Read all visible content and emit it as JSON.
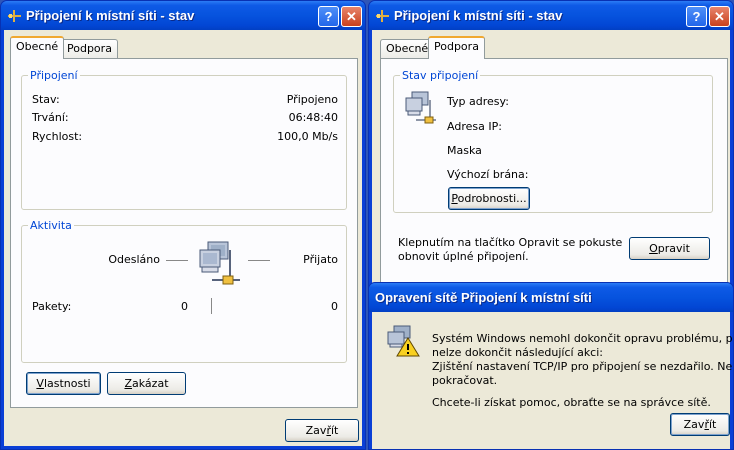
{
  "left_window": {
    "title": "Připojení k místní síti - stav",
    "help": "?",
    "close": "✕",
    "tabs": [
      "Obecné",
      "Podpora"
    ],
    "connection_group": {
      "legend": "Připojení",
      "rows": [
        {
          "label": "Stav:",
          "value": "Připojeno"
        },
        {
          "label": "Trvání:",
          "value": "06:48:40"
        },
        {
          "label": "Rychlost:",
          "value": "100,0 Mb/s"
        }
      ]
    },
    "activity_group": {
      "legend": "Aktivita",
      "sent_label": "Odesláno",
      "received_label": "Přijato",
      "packets_label": "Pakety:",
      "packets_sent": "0",
      "packets_received": "0"
    },
    "properties_button_pre": "",
    "properties_button_u": "V",
    "properties_button_post": "lastnosti",
    "disable_button_pre": "",
    "disable_button_u": "Z",
    "disable_button_post": "akázat",
    "close_button_pre": "Zav",
    "close_button_u": "ř",
    "close_button_post": "ít"
  },
  "right_window": {
    "title": "Připojení k místní síti - stav",
    "help": "?",
    "close": "✕",
    "tabs": [
      "Obecné",
      "Podpora"
    ],
    "status_group": {
      "legend": "Stav připojení",
      "rows": [
        "Typ adresy:",
        "Adresa IP:",
        "Maska",
        "Výchozí brána:"
      ],
      "details_button_pre": "",
      "details_button_u": "P",
      "details_button_post": "odrobnosti..."
    },
    "repair_text_line1": "Klepnutím na tlačítko Opravit se pokuste",
    "repair_text_line2": "obnovit úplné připojení.",
    "repair_button_pre": "",
    "repair_button_u": "O",
    "repair_button_post": "pravit"
  },
  "repair_dialog": {
    "title": "Opravení sítě Připojení k místní síti",
    "message_lines": [
      "Systém Windows nemohl dokončit opravu problému, protože",
      "nelze dokončit následující akci:",
      "Zjištění nastavení TCP/IP pro připojení se nezdařilo. Nelze",
      "pokračovat."
    ],
    "help_line": "Chcete-li získat pomoc, obraťte se na správce sítě.",
    "close_button_pre": "Zav",
    "close_button_u": "ř",
    "close_button_post": "ít"
  },
  "colors": {
    "title_blue": "#0653de",
    "group_legend": "#0046d5",
    "dialog_face": "#ece9d8"
  }
}
